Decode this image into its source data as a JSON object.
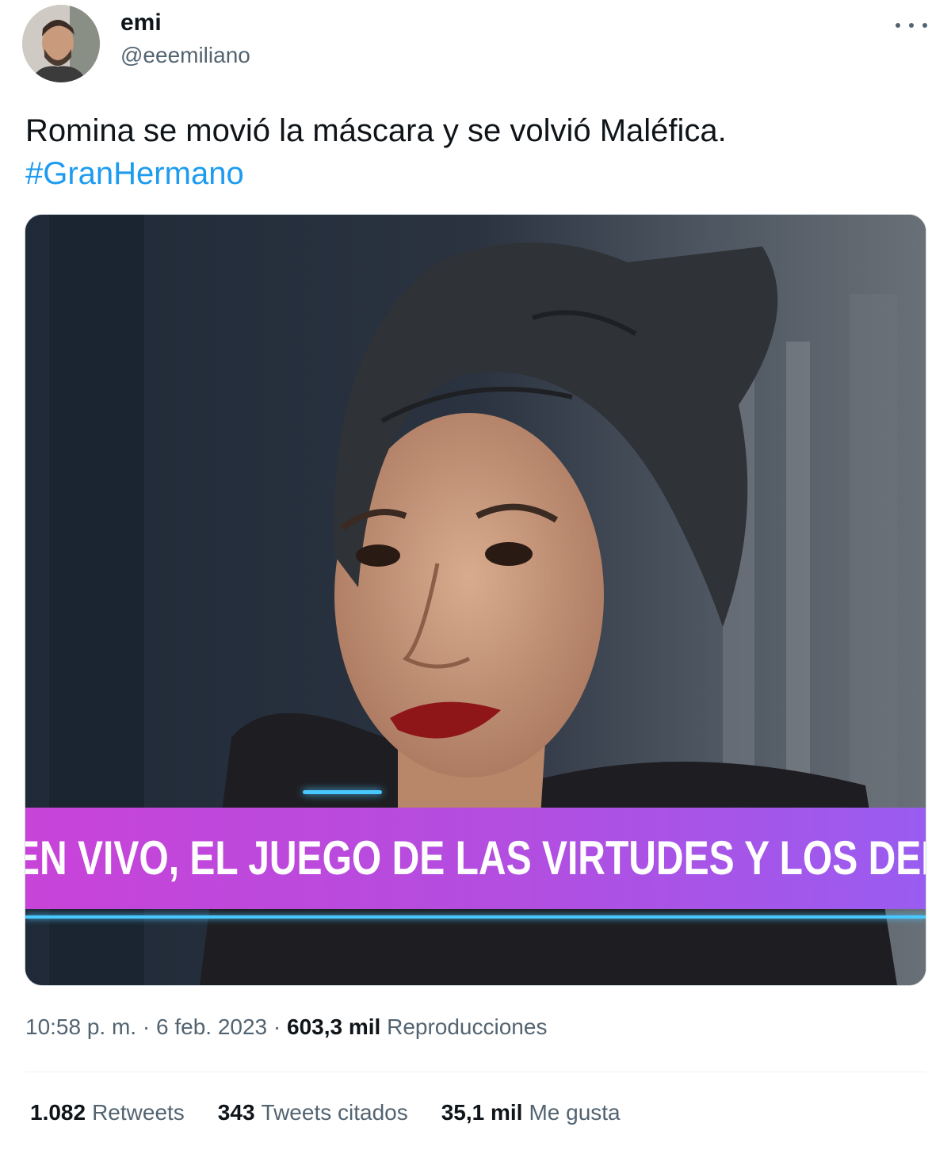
{
  "author": {
    "display_name": "emi",
    "handle": "@eeemiliano"
  },
  "tweet": {
    "text": "Romina se movió la máscara y se volvió Maléfica.",
    "hashtag": "#GranHermano"
  },
  "media": {
    "lower_third_text": "EN VIVO, EL JUEGO DE LAS VIRTUDES Y LOS DEFEC"
  },
  "meta": {
    "time": "10:58 p. m.",
    "separator": "·",
    "date": "6 feb. 2023",
    "views_count": "603,3 mil",
    "views_label": "Reproducciones"
  },
  "stats": {
    "retweets_count": "1.082",
    "retweets_label": "Retweets",
    "quotes_count": "343",
    "quotes_label": "Tweets citados",
    "likes_count": "35,1 mil",
    "likes_label": "Me gusta"
  },
  "colors": {
    "hashtag": "#1d9bf0",
    "secondary_text": "#536471",
    "lower_third": "#b24ee0",
    "accent_line": "#49c7ff"
  },
  "icons": [
    "more-icon"
  ]
}
